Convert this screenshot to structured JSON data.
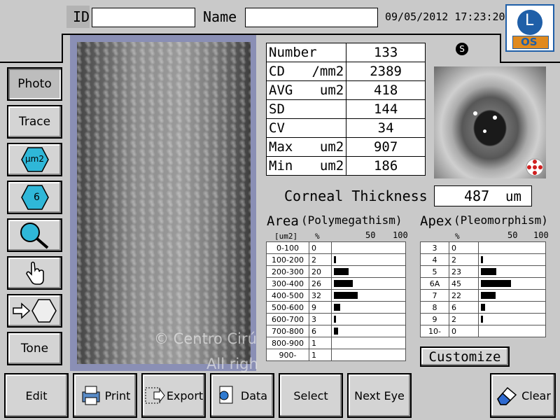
{
  "header": {
    "id_label": "ID",
    "id_value": "",
    "name_label": "Name",
    "name_value": "",
    "datetime": "09/05/2012 17:23:20",
    "eye_badge_letter": "L",
    "eye_badge_text": "OS"
  },
  "sidebar": {
    "photo": "Photo",
    "trace": "Trace",
    "um2": "μm2",
    "six": "6",
    "tone": "Tone"
  },
  "stats": [
    {
      "label": "Number",
      "unit": "",
      "value": "133"
    },
    {
      "label": "CD",
      "unit": "/mm2",
      "value": "2389"
    },
    {
      "label": "AVG",
      "unit": "um2",
      "value": "418"
    },
    {
      "label": "SD",
      "unit": "",
      "value": "144"
    },
    {
      "label": "CV",
      "unit": "",
      "value": "34"
    },
    {
      "label": "Max",
      "unit": "um2",
      "value": "907"
    },
    {
      "label": "Min",
      "unit": "um2",
      "value": "186"
    }
  ],
  "s_badge": "S",
  "corneal": {
    "label": "Corneal Thickness",
    "value": "487",
    "unit": "um"
  },
  "area": {
    "title": "Area",
    "subtitle": "(Polymegathism)",
    "col_unit": "[um2]",
    "col_pct": "%",
    "scale_50": "50",
    "scale_100": "100",
    "rows": [
      {
        "range": "0-100",
        "pct": "0",
        "p": 0
      },
      {
        "range": "100-200",
        "pct": "2",
        "p": 2
      },
      {
        "range": "200-300",
        "pct": "20",
        "p": 20
      },
      {
        "range": "300-400",
        "pct": "26",
        "p": 26
      },
      {
        "range": "400-500",
        "pct": "32",
        "p": 32
      },
      {
        "range": "500-600",
        "pct": "9",
        "p": 9
      },
      {
        "range": "600-700",
        "pct": "3",
        "p": 3
      },
      {
        "range": "700-800",
        "pct": "6",
        "p": 6
      },
      {
        "range": "800-900",
        "pct": "1",
        "p": 0
      },
      {
        "range": "900-",
        "pct": "1",
        "p": 0
      }
    ]
  },
  "apex": {
    "title": "Apex",
    "subtitle": "(Pleomorphism)",
    "col_pct": "%",
    "scale_50": "50",
    "scale_100": "100",
    "rows": [
      {
        "n": "3",
        "pct": "0",
        "p": 0
      },
      {
        "n": "4",
        "pct": "2",
        "p": 2
      },
      {
        "n": "5",
        "pct": "23",
        "p": 23
      },
      {
        "n": "6A",
        "pct": "45",
        "p": 45
      },
      {
        "n": "7",
        "pct": "22",
        "p": 22
      },
      {
        "n": "8",
        "pct": "6",
        "p": 6
      },
      {
        "n": "9",
        "pct": "2",
        "p": 2
      },
      {
        "n": "10-",
        "pct": "0",
        "p": 0
      }
    ]
  },
  "customize": "Customize",
  "watermark": {
    "line1": "© Centro Cirú",
    "line2": "All righ"
  },
  "bottom": {
    "edit": "Edit",
    "print": "Print",
    "export": "Export",
    "data": "Data",
    "select": "Select",
    "next_eye": "Next Eye",
    "clear": "Clear"
  },
  "colors": {
    "badge_blue": "#1f5fa8",
    "badge_orange": "#e08a1e",
    "hex_cyan": "#2fb7d8"
  }
}
